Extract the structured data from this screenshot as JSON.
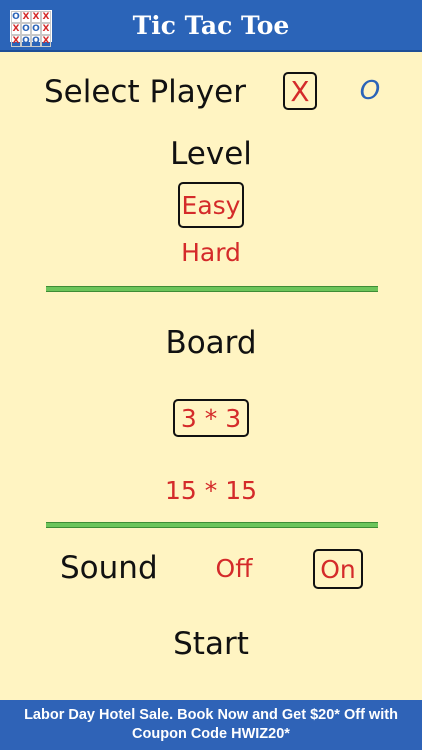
{
  "header": {
    "title": "Tic Tac Toe",
    "icon_cells": [
      "O",
      "X",
      "X",
      "X",
      "X",
      "O",
      "O",
      "X",
      "X",
      "O",
      "O",
      "X"
    ]
  },
  "player": {
    "label": "Select Player",
    "x_option": "X",
    "o_option": "O",
    "selected": "X"
  },
  "level": {
    "label": "Level",
    "options": [
      "Easy",
      "Hard"
    ],
    "selected": "Easy"
  },
  "board": {
    "label": "Board",
    "options": [
      "3 * 3",
      "15 * 15"
    ],
    "selected": "3 * 3"
  },
  "sound": {
    "label": "Sound",
    "options": [
      "Off",
      "On"
    ],
    "selected": "On"
  },
  "start_label": "Start",
  "ad": {
    "text": "Labor Day Hotel Sale. Book Now and Get $20* Off with Coupon Code HWIZ20*"
  },
  "colors": {
    "header_bg": "#2b64b8",
    "page_bg": "#fff4c2",
    "accent_red": "#d42a2a",
    "accent_blue": "#2b64b8",
    "divider_green": "#6cc45a"
  }
}
